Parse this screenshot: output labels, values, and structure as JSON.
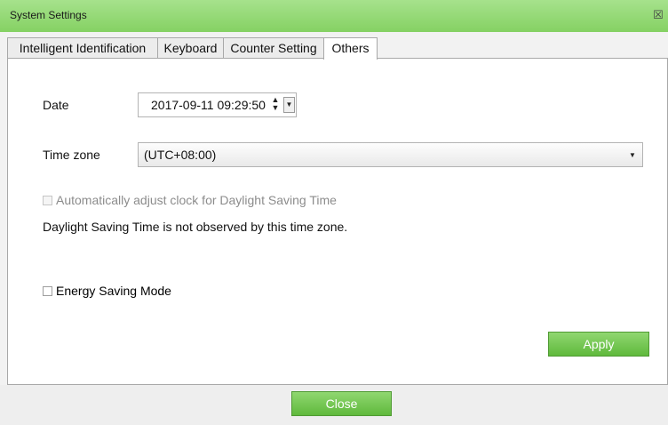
{
  "window": {
    "title": "System Settings",
    "close_glyph": "☒"
  },
  "tabs": [
    {
      "label": "Intelligent Identification",
      "active": false
    },
    {
      "label": "Keyboard",
      "active": false
    },
    {
      "label": "Counter Setting",
      "active": false
    },
    {
      "label": "Others",
      "active": true
    }
  ],
  "others": {
    "date_label": "Date",
    "date_value": "2017-09-11 09:29:50",
    "timezone_label": "Time zone",
    "timezone_value": "(UTC+08:00)",
    "dst_checkbox_label": "Automatically adjust clock for Daylight Saving Time",
    "dst_checkbox_checked": false,
    "dst_checkbox_enabled": false,
    "dst_note": "Daylight Saving Time is not observed by this time zone.",
    "energy_saving_label": "Energy Saving Mode",
    "energy_saving_checked": false,
    "apply_label": "Apply"
  },
  "footer": {
    "close_label": "Close"
  },
  "colors": {
    "title_bar": "#8fd66c",
    "button_green": "#6cc046"
  }
}
